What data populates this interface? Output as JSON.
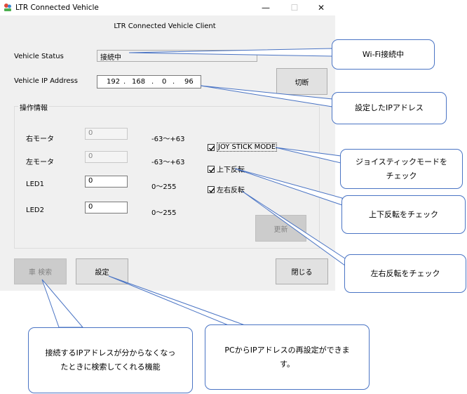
{
  "window": {
    "title": "LTR Connected Vehicle",
    "minimize": "—",
    "maximize": "☐",
    "close": "✕",
    "client_title": "LTR Connected Vehicle Client"
  },
  "status": {
    "label": "Vehicle Status",
    "value": "接続中"
  },
  "ip": {
    "label": "Vehicle IP Address",
    "octets": [
      "192",
      "168",
      "0",
      "96"
    ],
    "dot": "."
  },
  "buttons": {
    "disconnect": "切断",
    "update": "更新",
    "search": "車 検索",
    "settings": "設定",
    "close": "閉じる"
  },
  "group": {
    "title": "操作情報",
    "rows": [
      {
        "label": "右モータ",
        "value": "0",
        "range": "-63〜+63"
      },
      {
        "label": "左モータ",
        "value": "0",
        "range": "-63〜+63"
      },
      {
        "label": "LED1",
        "value": "0",
        "range": "0〜255"
      },
      {
        "label": "LED2",
        "value": "0",
        "range": "0〜255"
      }
    ],
    "checkboxes": [
      {
        "label": "JOY STICK MODE",
        "checked": true
      },
      {
        "label": "上下反転",
        "checked": true
      },
      {
        "label": "左右反転",
        "checked": true
      }
    ]
  },
  "callouts": {
    "wifi": "Wi-Fi接続中",
    "ip_set": "設定したIPアドレス",
    "joystick_1": "ジョイスティックモードを",
    "joystick_2": "チェック",
    "updown": "上下反転をチェック",
    "leftright": "左右反転をチェック",
    "search_1": "接続するIPアドレスが分からなくなっ",
    "search_2": "たときに検索してくれる機能",
    "reset_1": "PCからIPアドレスの再設定ができま",
    "reset_2": "す。"
  },
  "colors": {
    "window_bg": "#f0f0f0",
    "callout_border": "#4a74c4",
    "button_bg": "#e1e1e1",
    "disabled_button_bg": "#cccccc"
  },
  "icons": {
    "app": "vehicle-app-icon",
    "check": "checkmark-icon"
  }
}
